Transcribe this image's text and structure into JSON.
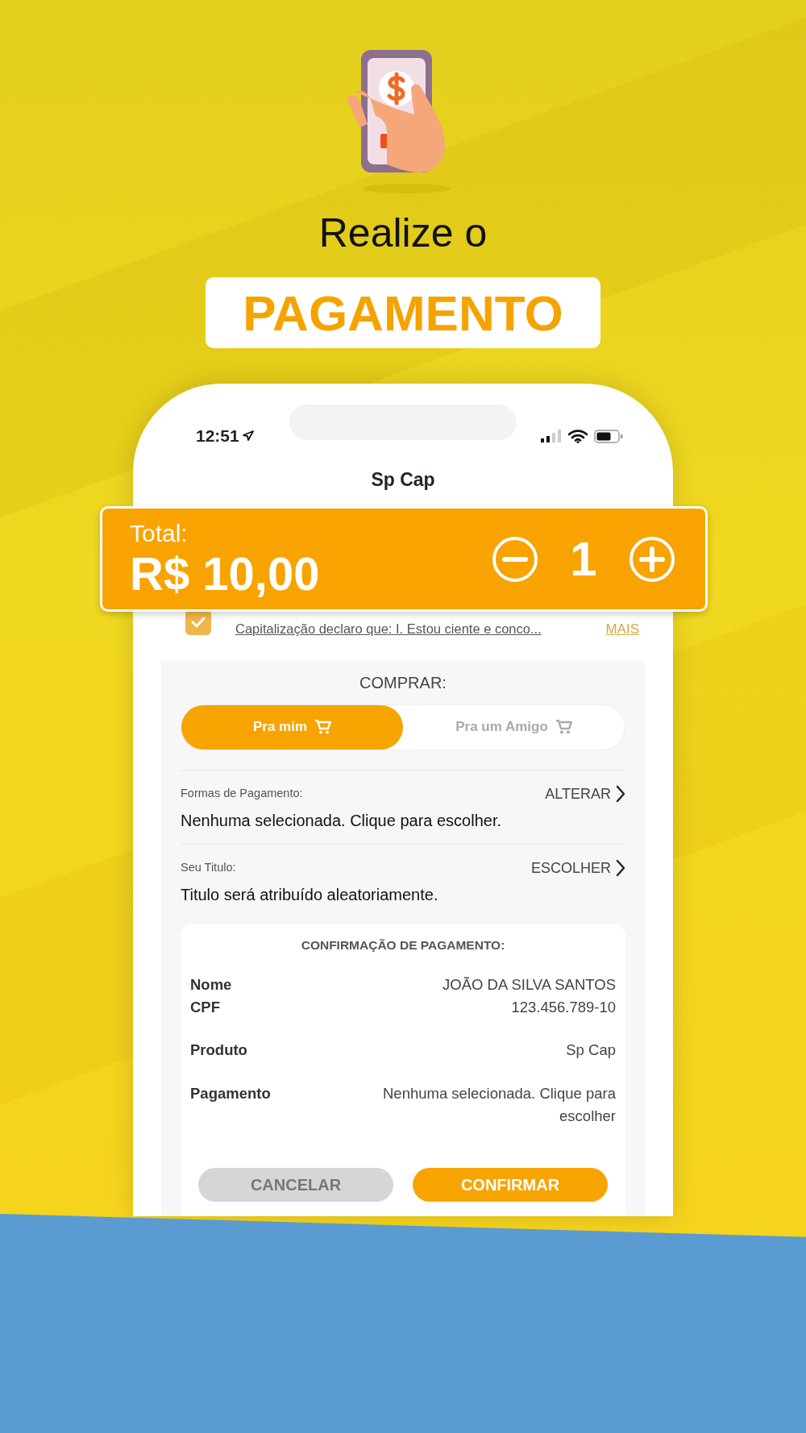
{
  "header": {
    "title": "Realize o",
    "highlight": "PAGAMENTO"
  },
  "status_bar": {
    "time": "12:51"
  },
  "app_title": "Sp Cap",
  "total": {
    "label": "Total:",
    "amount": "R$ 10,00",
    "quantity": "1"
  },
  "terms": {
    "checked": true,
    "text": "Capitalização declaro que: I. Estou ciente e conco...",
    "link": "MAIS"
  },
  "purchase": {
    "label": "COMPRAR:",
    "options": [
      {
        "label": "Pra mim",
        "selected": true
      },
      {
        "label": "Pra um Amigo",
        "selected": false
      }
    ]
  },
  "fields": [
    {
      "label": "Formas de Pagamento:",
      "action": "ALTERAR",
      "value": "Nenhuma selecionada. Clique para escolher."
    },
    {
      "label": "Seu Titulo:",
      "action": "ESCOLHER",
      "value": "Titulo será atribuído aleatoriamente."
    }
  ],
  "confirmation": {
    "title": "CONFIRMAÇÃO DE PAGAMENTO:",
    "groups": [
      {
        "rows": [
          {
            "label": "Nome",
            "value": "JOÃO DA SILVA SANTOS"
          },
          {
            "label": "CPF",
            "value": "123.456.789-10"
          }
        ]
      },
      {
        "rows": [
          {
            "label": "Produto",
            "value": "Sp Cap"
          }
        ]
      },
      {
        "rows": [
          {
            "label": "Pagamento",
            "value": "Nenhuma selecionada. Clique para escolher"
          }
        ]
      }
    ]
  },
  "buttons": [
    {
      "label": "CANCELAR",
      "kind": "secondary"
    },
    {
      "label": "CONFIRMAR",
      "kind": "primary"
    }
  ]
}
